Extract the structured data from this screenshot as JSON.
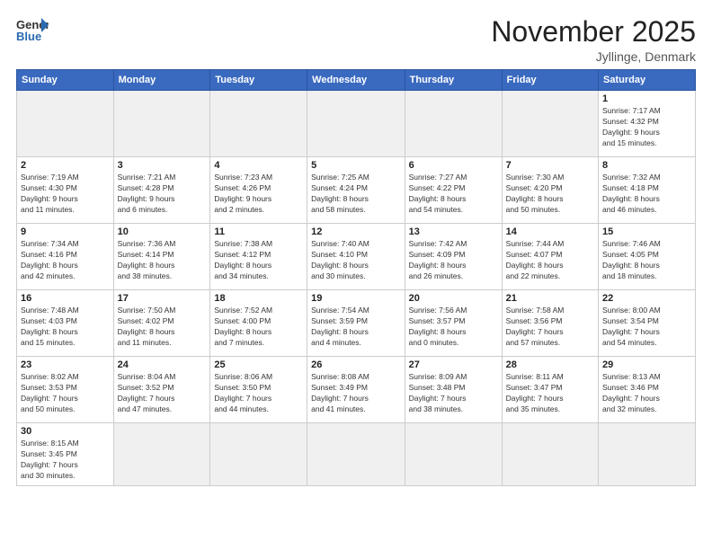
{
  "logo": {
    "text_general": "General",
    "text_blue": "Blue"
  },
  "header": {
    "month_title": "November 2025",
    "location": "Jyllinge, Denmark"
  },
  "weekdays": [
    "Sunday",
    "Monday",
    "Tuesday",
    "Wednesday",
    "Thursday",
    "Friday",
    "Saturday"
  ],
  "weeks": [
    [
      {
        "day": "",
        "info": "",
        "empty": true
      },
      {
        "day": "",
        "info": "",
        "empty": true
      },
      {
        "day": "",
        "info": "",
        "empty": true
      },
      {
        "day": "",
        "info": "",
        "empty": true
      },
      {
        "day": "",
        "info": "",
        "empty": true
      },
      {
        "day": "",
        "info": "",
        "empty": true
      },
      {
        "day": "1",
        "info": "Sunrise: 7:17 AM\nSunset: 4:32 PM\nDaylight: 9 hours\nand 15 minutes."
      }
    ],
    [
      {
        "day": "2",
        "info": "Sunrise: 7:19 AM\nSunset: 4:30 PM\nDaylight: 9 hours\nand 11 minutes."
      },
      {
        "day": "3",
        "info": "Sunrise: 7:21 AM\nSunset: 4:28 PM\nDaylight: 9 hours\nand 6 minutes."
      },
      {
        "day": "4",
        "info": "Sunrise: 7:23 AM\nSunset: 4:26 PM\nDaylight: 9 hours\nand 2 minutes."
      },
      {
        "day": "5",
        "info": "Sunrise: 7:25 AM\nSunset: 4:24 PM\nDaylight: 8 hours\nand 58 minutes."
      },
      {
        "day": "6",
        "info": "Sunrise: 7:27 AM\nSunset: 4:22 PM\nDaylight: 8 hours\nand 54 minutes."
      },
      {
        "day": "7",
        "info": "Sunrise: 7:30 AM\nSunset: 4:20 PM\nDaylight: 8 hours\nand 50 minutes."
      },
      {
        "day": "8",
        "info": "Sunrise: 7:32 AM\nSunset: 4:18 PM\nDaylight: 8 hours\nand 46 minutes."
      }
    ],
    [
      {
        "day": "9",
        "info": "Sunrise: 7:34 AM\nSunset: 4:16 PM\nDaylight: 8 hours\nand 42 minutes."
      },
      {
        "day": "10",
        "info": "Sunrise: 7:36 AM\nSunset: 4:14 PM\nDaylight: 8 hours\nand 38 minutes."
      },
      {
        "day": "11",
        "info": "Sunrise: 7:38 AM\nSunset: 4:12 PM\nDaylight: 8 hours\nand 34 minutes."
      },
      {
        "day": "12",
        "info": "Sunrise: 7:40 AM\nSunset: 4:10 PM\nDaylight: 8 hours\nand 30 minutes."
      },
      {
        "day": "13",
        "info": "Sunrise: 7:42 AM\nSunset: 4:09 PM\nDaylight: 8 hours\nand 26 minutes."
      },
      {
        "day": "14",
        "info": "Sunrise: 7:44 AM\nSunset: 4:07 PM\nDaylight: 8 hours\nand 22 minutes."
      },
      {
        "day": "15",
        "info": "Sunrise: 7:46 AM\nSunset: 4:05 PM\nDaylight: 8 hours\nand 18 minutes."
      }
    ],
    [
      {
        "day": "16",
        "info": "Sunrise: 7:48 AM\nSunset: 4:03 PM\nDaylight: 8 hours\nand 15 minutes."
      },
      {
        "day": "17",
        "info": "Sunrise: 7:50 AM\nSunset: 4:02 PM\nDaylight: 8 hours\nand 11 minutes."
      },
      {
        "day": "18",
        "info": "Sunrise: 7:52 AM\nSunset: 4:00 PM\nDaylight: 8 hours\nand 7 minutes."
      },
      {
        "day": "19",
        "info": "Sunrise: 7:54 AM\nSunset: 3:59 PM\nDaylight: 8 hours\nand 4 minutes."
      },
      {
        "day": "20",
        "info": "Sunrise: 7:56 AM\nSunset: 3:57 PM\nDaylight: 8 hours\nand 0 minutes."
      },
      {
        "day": "21",
        "info": "Sunrise: 7:58 AM\nSunset: 3:56 PM\nDaylight: 7 hours\nand 57 minutes."
      },
      {
        "day": "22",
        "info": "Sunrise: 8:00 AM\nSunset: 3:54 PM\nDaylight: 7 hours\nand 54 minutes."
      }
    ],
    [
      {
        "day": "23",
        "info": "Sunrise: 8:02 AM\nSunset: 3:53 PM\nDaylight: 7 hours\nand 50 minutes."
      },
      {
        "day": "24",
        "info": "Sunrise: 8:04 AM\nSunset: 3:52 PM\nDaylight: 7 hours\nand 47 minutes."
      },
      {
        "day": "25",
        "info": "Sunrise: 8:06 AM\nSunset: 3:50 PM\nDaylight: 7 hours\nand 44 minutes."
      },
      {
        "day": "26",
        "info": "Sunrise: 8:08 AM\nSunset: 3:49 PM\nDaylight: 7 hours\nand 41 minutes."
      },
      {
        "day": "27",
        "info": "Sunrise: 8:09 AM\nSunset: 3:48 PM\nDaylight: 7 hours\nand 38 minutes."
      },
      {
        "day": "28",
        "info": "Sunrise: 8:11 AM\nSunset: 3:47 PM\nDaylight: 7 hours\nand 35 minutes."
      },
      {
        "day": "29",
        "info": "Sunrise: 8:13 AM\nSunset: 3:46 PM\nDaylight: 7 hours\nand 32 minutes."
      }
    ],
    [
      {
        "day": "30",
        "info": "Sunrise: 8:15 AM\nSunset: 3:45 PM\nDaylight: 7 hours\nand 30 minutes."
      },
      {
        "day": "",
        "info": "",
        "empty": true
      },
      {
        "day": "",
        "info": "",
        "empty": true
      },
      {
        "day": "",
        "info": "",
        "empty": true
      },
      {
        "day": "",
        "info": "",
        "empty": true
      },
      {
        "day": "",
        "info": "",
        "empty": true
      },
      {
        "day": "",
        "info": "",
        "empty": true
      }
    ]
  ]
}
